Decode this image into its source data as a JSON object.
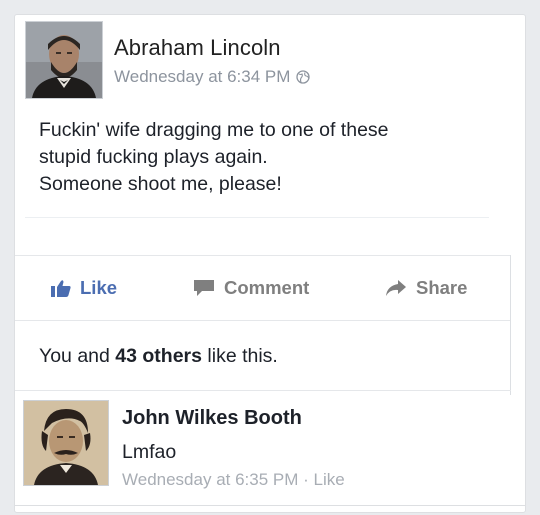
{
  "post": {
    "author": "Abraham Lincoln",
    "timestamp": "Wednesday at 6:34 PM",
    "audience_icon": "globe-icon",
    "lines": [
      "Fuckin' wife dragging me to one of these",
      "stupid fucking plays again.",
      "Someone shoot me, please!"
    ]
  },
  "actions": {
    "like": "Like",
    "comment": "Comment",
    "share": "Share",
    "like_color": "#4b6db1",
    "icons": [
      "thumbs-up-icon",
      "comment-bubble-icon",
      "share-arrow-icon"
    ]
  },
  "likes": {
    "prefix": "You and ",
    "count": "43 others",
    "suffix": " like this."
  },
  "comment": {
    "author": "John Wilkes Booth",
    "text": "Lmfao",
    "timestamp": "Wednesday at 6:35 PM",
    "separator": " · ",
    "like_label": "Like"
  }
}
